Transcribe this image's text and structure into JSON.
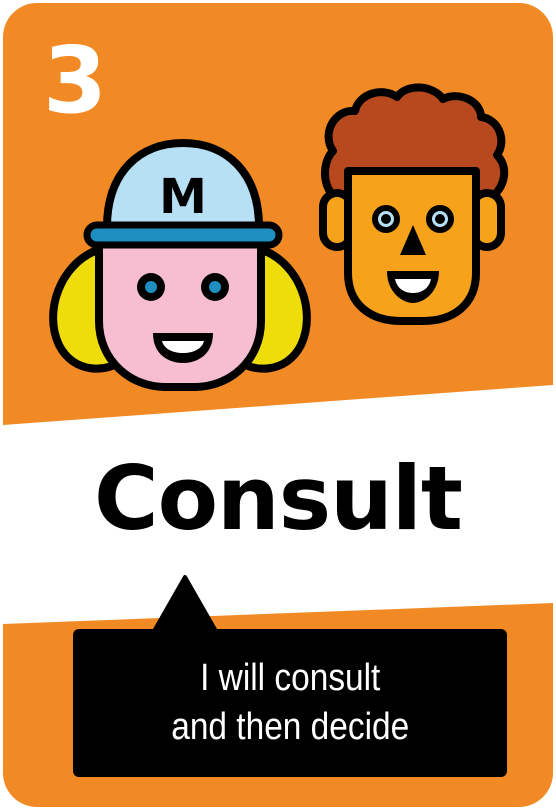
{
  "card": {
    "number": "3",
    "title": "Consult",
    "description": "I will consult\nand then decide"
  },
  "characters": [
    {
      "name": "woman-with-cap",
      "cap_letter": "M"
    },
    {
      "name": "man-curly-hair"
    }
  ],
  "colors": {
    "orange": "#F18A24",
    "black": "#000000",
    "white": "#FFFFFF",
    "cap_blue": "#B8E0F5",
    "skin_pink": "#F7BDD0",
    "hair_yellow": "#EEDD0A",
    "skin_orange": "#F6A21B",
    "hair_brown": "#B8481E",
    "eye_blue": "#1E8FC0"
  }
}
